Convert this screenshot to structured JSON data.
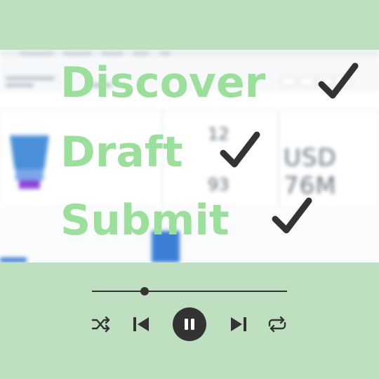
{
  "overlay": {
    "words": [
      "Discover",
      "Draft",
      "Submit"
    ],
    "check_icon": "check-icon",
    "text_color": "#9be09a",
    "check_color": "#333333"
  },
  "dashboard": {
    "number_top": "12",
    "number_bottom": "93",
    "currency_value": "USD 76M"
  },
  "player": {
    "progress": 0.27,
    "icons": [
      "shuffle-icon",
      "previous-icon",
      "pause-icon",
      "next-icon",
      "repeat-icon"
    ],
    "accent": "#333333",
    "background": "#bfe0c0"
  }
}
